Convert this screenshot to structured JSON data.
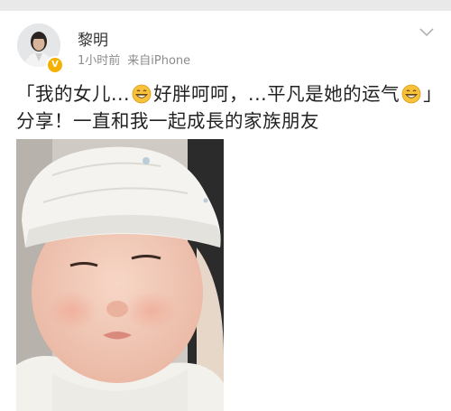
{
  "post": {
    "author": "黎明",
    "time": "1小时前",
    "source": "来自iPhone",
    "verified_badge": "V",
    "text_segments": [
      "「我的女儿...",
      "好胖呵呵，...平凡是她的运气",
      "」分享！一直和我一起成長的家族朋友"
    ],
    "emoji_name": "grinning-face",
    "photo_subject": "baby-in-white-cap"
  },
  "colors": {
    "badge": "#f6b100",
    "meta_text": "#8c8c8c",
    "body_text": "#222222",
    "top_bar": "#e9e9e9"
  }
}
